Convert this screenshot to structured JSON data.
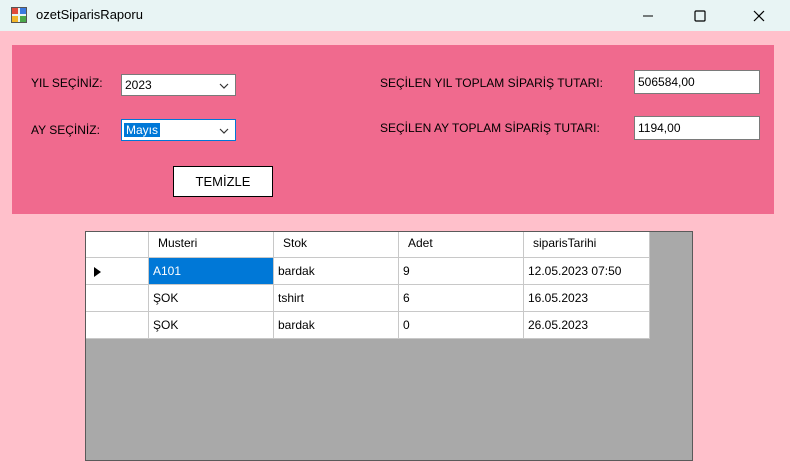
{
  "window": {
    "title": "ozetSiparisRaporu",
    "app_icon": "form-icon",
    "controls": {
      "minimize": "minimize-icon",
      "maximize": "maximize-icon",
      "close": "close-icon"
    }
  },
  "filters": {
    "year_label": "YIL SEÇİNİZ:",
    "year_value": "2023",
    "month_label": "AY SEÇİNİZ:",
    "month_value": "Mayıs",
    "clear_button": "TEMİZLE"
  },
  "totals": {
    "year_total_label": "SEÇİLEN YIL TOPLAM SİPARİŞ TUTARI:",
    "year_total_value": "506584,00",
    "month_total_label": "SEÇİLEN AY TOPLAM SİPARİŞ TUTARI:",
    "month_total_value": "1194,00"
  },
  "grid": {
    "columns": [
      "Musteri",
      "Stok",
      "Adet",
      "siparisTarihi"
    ],
    "rows": [
      [
        "A101",
        "bardak",
        "9",
        "12.05.2023 07:50"
      ],
      [
        "ŞOK",
        "tshirt",
        "6",
        "16.05.2023"
      ],
      [
        "ŞOK",
        "bardak",
        "0",
        "26.05.2023"
      ]
    ],
    "current_row_indicator": "row-pointer-icon"
  },
  "colors": {
    "background": "#ffc0cb",
    "panel": "#f06a8e",
    "grid_background": "#a9a9a9",
    "selection": "#0078d7"
  }
}
